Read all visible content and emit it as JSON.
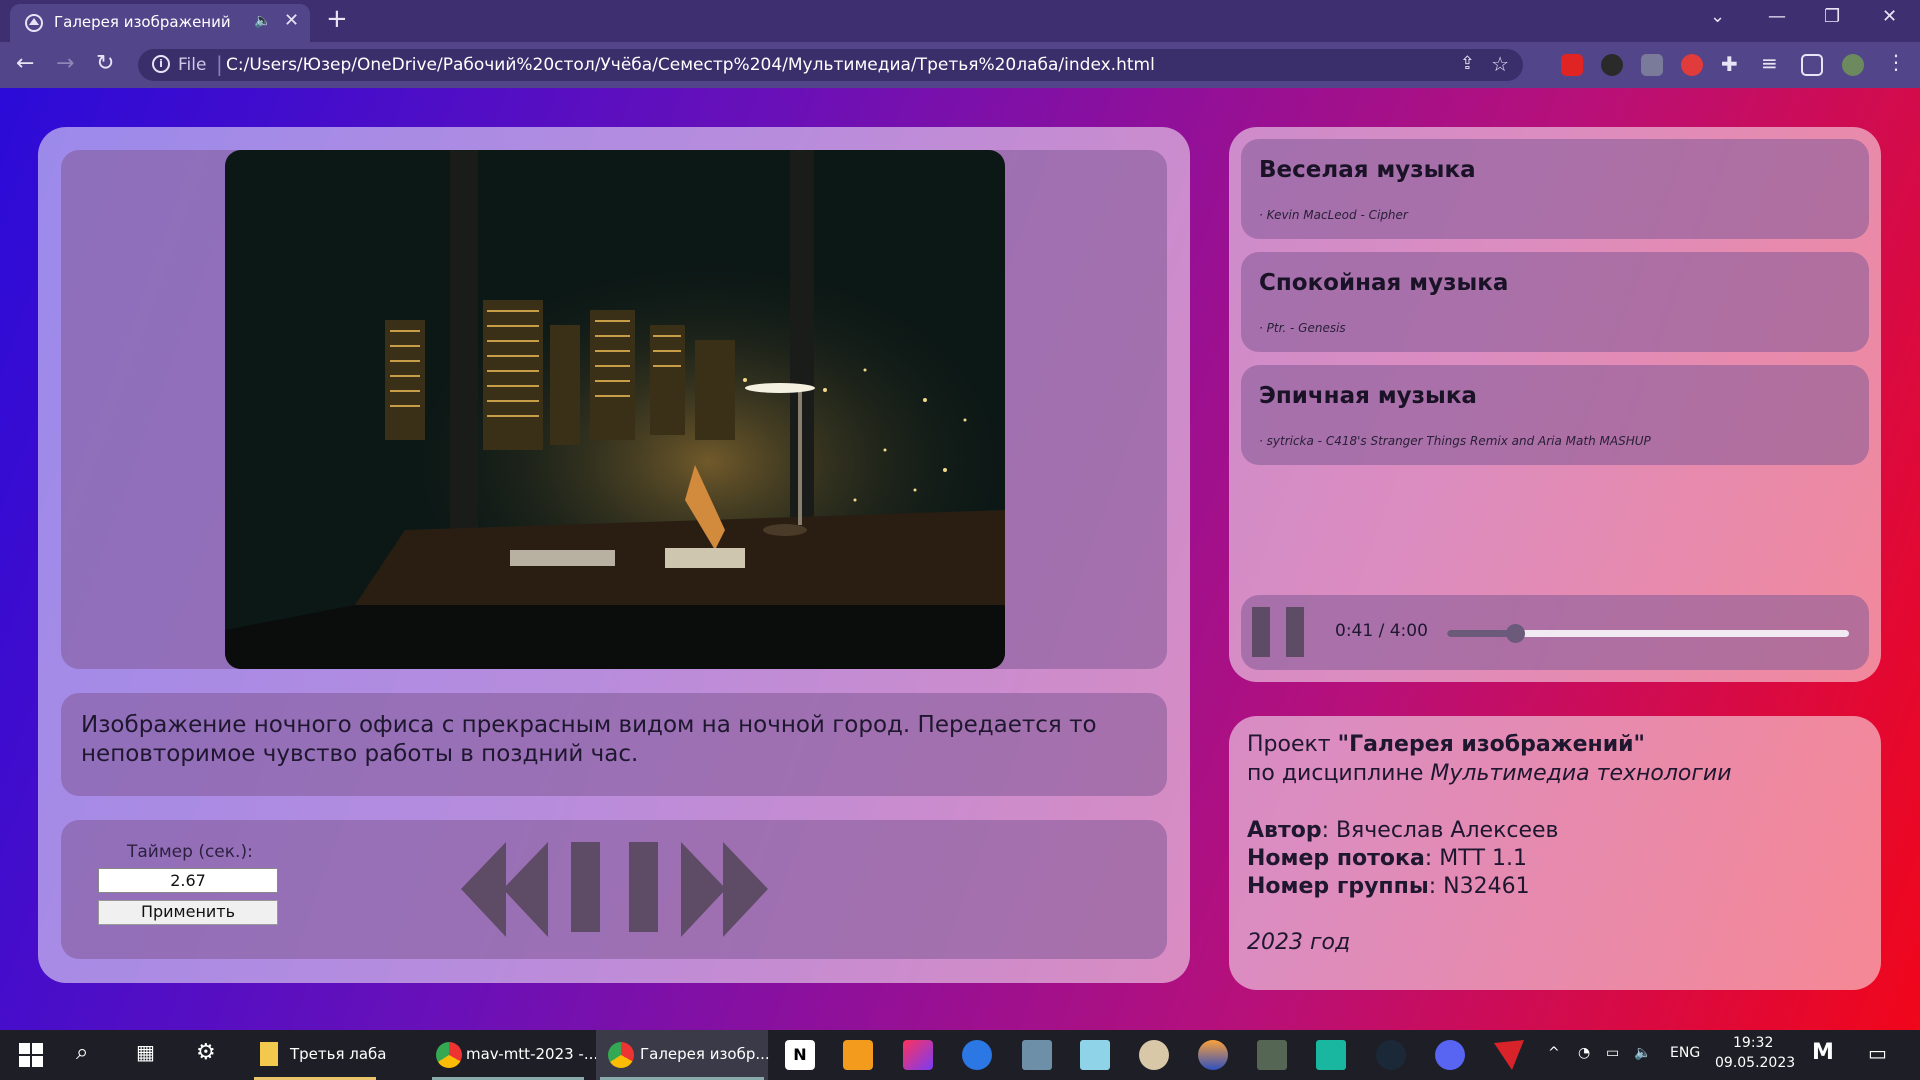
{
  "browser": {
    "tab_title": "Галерея изображений",
    "url_scheme": "File",
    "url": "C:/Users/Юзер/OneDrive/Рабочий%20стол/Учёба/Семестр%204/Мультимедиа/Третья%20лаба/index.html",
    "icons": [
      "back-arrow-icon",
      "forward-arrow-icon",
      "reload-icon",
      "info-icon",
      "share-icon",
      "star-icon",
      "extensions-icon",
      "menu-icon"
    ]
  },
  "gallery": {
    "image_alt": "night office with city view",
    "description": "Изображение ночного офиса с прекрасным видом на ночной город. Передается то неповторимое чувство работы в поздний час.",
    "timer_label": "Таймер (сек.):",
    "timer_value": "2.67",
    "apply_label": "Применить",
    "controls": [
      "previous-icon",
      "pause-icon",
      "next-icon"
    ]
  },
  "music": {
    "tracks": [
      {
        "title": "Веселая музыка",
        "artist": "· Kevin MacLeod - Cipher"
      },
      {
        "title": "Спокойная музыка",
        "artist": "· Ptr. - Genesis"
      },
      {
        "title": "Эпичная музыка",
        "artist": "· sytricka - C418's Stranger Things Remix and Aria Math MASHUP"
      }
    ],
    "player": {
      "time": "0:41 / 4:00",
      "progress_fraction": 0.17
    }
  },
  "info": {
    "project_prefix": "Проект ",
    "project_name": "\"Галерея изображений\"",
    "discipline_prefix": "по дисциплине ",
    "discipline": "Мультимедиа технологии",
    "author_label": "Автор",
    "author": ": Вячеслав Алексеев",
    "stream_label": "Номер потока",
    "stream": ": МТТ 1.1",
    "group_label": "Номер группы",
    "group": ": N32461",
    "year": "2023 год"
  },
  "taskbar": {
    "apps": [
      {
        "label": "Третья лаба"
      },
      {
        "label": "mav-mtt-2023 -..."
      },
      {
        "label": "Галерея изобр..."
      }
    ],
    "lang": "ENG",
    "time": "19:32",
    "date": "09.05.2023"
  },
  "colors": {
    "bg_start": "#2b0bd8",
    "bg_end": "#f1061a",
    "accent": "#6b5a7a"
  }
}
